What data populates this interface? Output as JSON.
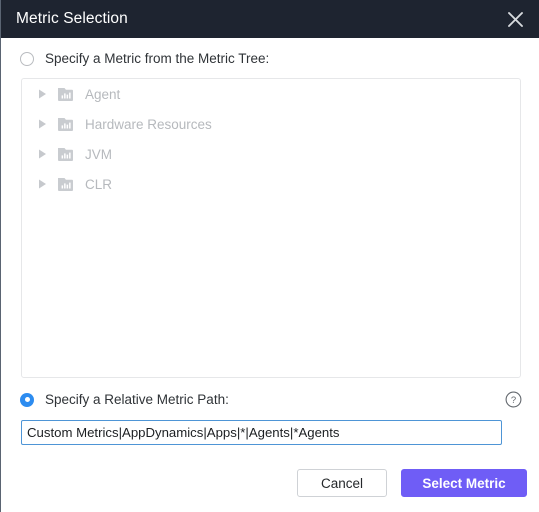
{
  "window": {
    "title": "Metric Selection",
    "close_icon": "close-icon",
    "titlebar_color": "#1e2430"
  },
  "options": {
    "tree": {
      "label": "Specify a Metric from the Metric Tree:",
      "selected": false
    },
    "path": {
      "label": "Specify a Relative Metric Path:",
      "selected": true,
      "radio_color": "#2d8cf0"
    }
  },
  "tree": {
    "items": [
      {
        "label": "Agent",
        "caret_icon": "chevron-right-icon",
        "node_icon": "metric-folder-icon",
        "expanded": false
      },
      {
        "label": "Hardware Resources",
        "caret_icon": "chevron-right-icon",
        "node_icon": "metric-folder-icon",
        "expanded": false
      },
      {
        "label": "JVM",
        "caret_icon": "chevron-right-icon",
        "node_icon": "metric-folder-icon",
        "expanded": false
      },
      {
        "label": "CLR",
        "caret_icon": "chevron-right-icon",
        "node_icon": "metric-folder-icon",
        "expanded": false
      }
    ]
  },
  "help": {
    "icon": "help-circle-icon"
  },
  "path_field": {
    "value": "Custom Metrics|AppDynamics|Apps|*|Agents|*Agents",
    "placeholder": "Custom Metrics|AppDynamics|Apps|*|Agents|*Agents"
  },
  "footer": {
    "cancel_label": "Cancel",
    "select_label": "Select Metric",
    "primary_color": "#6f5df6"
  }
}
